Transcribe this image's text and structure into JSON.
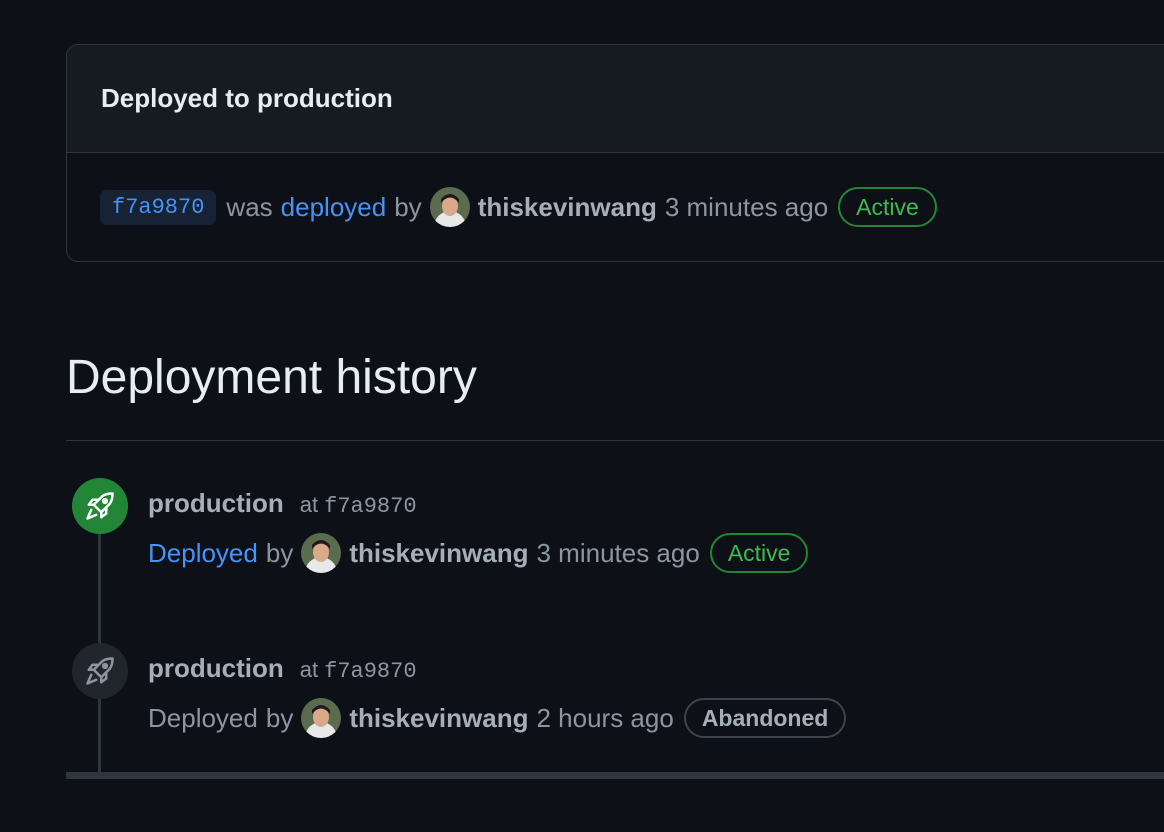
{
  "card": {
    "title": "Deployed to production",
    "sha": "f7a9870",
    "was": "was",
    "deployed_link": "deployed",
    "by": "by",
    "user": "thiskevinwang",
    "time": "3 minutes ago",
    "status": "Active"
  },
  "history": {
    "title": "Deployment history",
    "entries": [
      {
        "environment": "production",
        "at_label": "at",
        "sha": "f7a9870",
        "deployed": "Deployed",
        "by": "by",
        "user": "thiskevinwang",
        "time": "3 minutes ago",
        "status": "Active",
        "icon": "rocket-icon",
        "icon_color": "#238636"
      },
      {
        "environment": "production",
        "at_label": "at",
        "sha": "f7a9870",
        "deployed": "Deployed",
        "by": "by",
        "user": "thiskevinwang",
        "time": "2 hours ago",
        "status": "Abandoned",
        "icon": "rocket-icon",
        "icon_color": "#21262d"
      }
    ]
  },
  "colors": {
    "background": "#0d1117",
    "link": "#4493f8",
    "success": "#3fb950",
    "border": "#30363d"
  }
}
